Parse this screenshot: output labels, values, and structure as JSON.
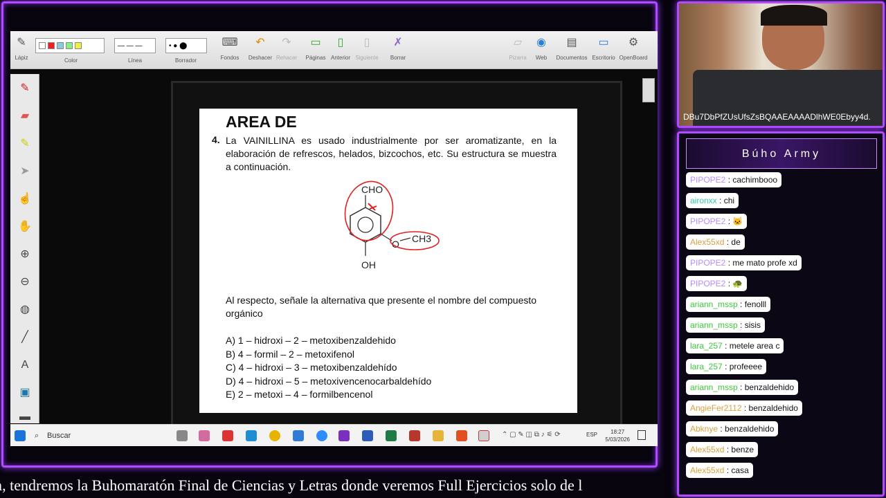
{
  "toolbar": {
    "items": [
      "Lápiz",
      "Color",
      "Línea",
      "Borrador",
      "Fondos",
      "Deshacer",
      "Rehacer",
      "Páginas",
      "Anterior",
      "Siguiente",
      "Borrar",
      "Pizarra",
      "Web",
      "Documentos",
      "Escritorio",
      "OpenBoard"
    ]
  },
  "document": {
    "heading": "AREA DE",
    "question_number": "4.",
    "question_text": "La VAINILLINA es usado industrialmente por ser aromatizante, en la elaboración de refrescos, helados, bizcochos, etc. Su estructura se muestra a continuación.",
    "molecule": {
      "top": "CHO",
      "right_o": "O",
      "right_ch3": "CH3",
      "bottom": "OH"
    },
    "prompt": "Al respecto, señale la alternativa que presente el nombre del compuesto orgánico",
    "options": [
      "A) 1 – hidroxi – 2 – metoxibenzaldehido",
      "B) 4 – formil – 2 – metoxifenol",
      "C) 4 – hidroxi – 3 – metoxibenzaldehído",
      "D) 4 – hidroxi – 5 – metoxivencenocarbaldehído",
      "E) 2 – metoxi – 4 – formilbencenol"
    ]
  },
  "taskbar": {
    "search_label": "Buscar",
    "time": "18:27",
    "date": "5/03/2026",
    "lang": "ESP"
  },
  "ticker": "m, tendremos la Buhomaratón Final de Ciencias y Letras donde veremos Full Ejercicios solo de l",
  "cam": {
    "title": "DBu7DbPfZUsUfsZsBQAAEAAAADlhWE0Ebyy4d."
  },
  "chat": {
    "title": "Búho Army",
    "messages": [
      {
        "user": "PIPOPE2",
        "text": "cachimbooo",
        "color": "#b58cff"
      },
      {
        "user": "aironxx",
        "text": "chi",
        "color": "#35c9a8"
      },
      {
        "user": "PIPOPE2",
        "text": "🐱",
        "color": "#b58cff"
      },
      {
        "user": "Alex55xd",
        "text": "de",
        "color": "#d9a040"
      },
      {
        "user": "PIPOPE2",
        "text": "me mato profe xd",
        "color": "#b58cff"
      },
      {
        "user": "PIPOPE2",
        "text": "🐢",
        "color": "#b58cff"
      },
      {
        "user": "ariann_mssp",
        "text": "fenolll",
        "color": "#3cc83c"
      },
      {
        "user": "ariann_mssp",
        "text": "sisis",
        "color": "#3cc83c"
      },
      {
        "user": "lara_257",
        "text": "metele area c",
        "color": "#3cc83c"
      },
      {
        "user": "lara_257",
        "text": "profeeee",
        "color": "#3cc83c"
      },
      {
        "user": "ariann_mssp",
        "text": "benzaldehido",
        "color": "#3cc83c"
      },
      {
        "user": "AngieFer2112",
        "text": "benzaldehido",
        "color": "#d9a040"
      },
      {
        "user": "Abknye",
        "text": "benzaldehido",
        "color": "#d9a040"
      },
      {
        "user": "Alex55xd",
        "text": "benze",
        "color": "#d9a040"
      },
      {
        "user": "Alex55xd",
        "text": "casa",
        "color": "#d9a040"
      }
    ]
  }
}
